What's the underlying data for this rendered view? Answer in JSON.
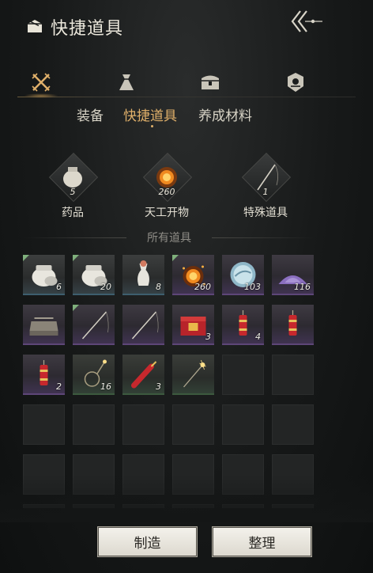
{
  "header": {
    "title": "快捷道具",
    "title_icon": "box-icon",
    "back_icon": "double-chevron-back-icon"
  },
  "category_tabs": [
    {
      "name": "weapons",
      "icon": "crossed-swords-icon",
      "active": true
    },
    {
      "name": "pouch",
      "icon": "pouch-icon",
      "active": false
    },
    {
      "name": "chest",
      "icon": "chest-icon",
      "active": false
    },
    {
      "name": "badge",
      "icon": "badge-icon",
      "active": false
    }
  ],
  "sub_tabs": [
    {
      "label": "装备",
      "active": false
    },
    {
      "label": "快捷道具",
      "active": true
    },
    {
      "label": "养成材料",
      "active": false
    }
  ],
  "groups": [
    {
      "count": "5",
      "label": "药品",
      "icon": "jar-icon"
    },
    {
      "count": "260",
      "label": "天工开物",
      "icon": "firework-spark-icon"
    },
    {
      "count": "1",
      "label": "特殊道具",
      "icon": "fishing-rod-icon"
    }
  ],
  "all_items_label": "所有道具",
  "items": [
    {
      "icon": "white-jar-icon",
      "qty": "6",
      "rarity": "white",
      "new": true
    },
    {
      "icon": "white-jar-icon",
      "qty": "20",
      "rarity": "white",
      "new": true
    },
    {
      "icon": "vase-icon",
      "qty": "8",
      "rarity": "white",
      "new": false
    },
    {
      "icon": "firework-spark-icon",
      "qty": "260",
      "rarity": "purple",
      "new": true
    },
    {
      "icon": "pearl-icon",
      "qty": "103",
      "rarity": "purple",
      "new": false
    },
    {
      "icon": "purple-powder-icon",
      "qty": "116",
      "rarity": "purple",
      "new": false
    },
    {
      "icon": "bed-frame-icon",
      "qty": "",
      "rarity": "purple",
      "new": false
    },
    {
      "icon": "fishing-rod-icon",
      "qty": "",
      "rarity": "purple",
      "new": true
    },
    {
      "icon": "fishing-rod-icon",
      "qty": "",
      "rarity": "purple",
      "new": false
    },
    {
      "icon": "red-gift-box-icon",
      "qty": "3",
      "rarity": "purple",
      "new": false
    },
    {
      "icon": "firecracker-icon",
      "qty": "4",
      "rarity": "purple",
      "new": false
    },
    {
      "icon": "firecracker-icon",
      "qty": "",
      "rarity": "purple",
      "new": false
    },
    {
      "icon": "firecracker-icon",
      "qty": "2",
      "rarity": "purple",
      "new": false
    },
    {
      "icon": "sparkler-loop-icon",
      "qty": "16",
      "rarity": "green",
      "new": false
    },
    {
      "icon": "rocket-icon",
      "qty": "3",
      "rarity": "green",
      "new": false
    },
    {
      "icon": "sparkler-icon",
      "qty": "",
      "rarity": "green",
      "new": false
    }
  ],
  "buttons": {
    "craft": "制造",
    "sort": "整理"
  },
  "colors": {
    "accent": "#e0b06a",
    "purple_rarity": "#5d4678",
    "green_rarity": "#3c5a3e",
    "white_rarity": "#3d5e6e"
  }
}
